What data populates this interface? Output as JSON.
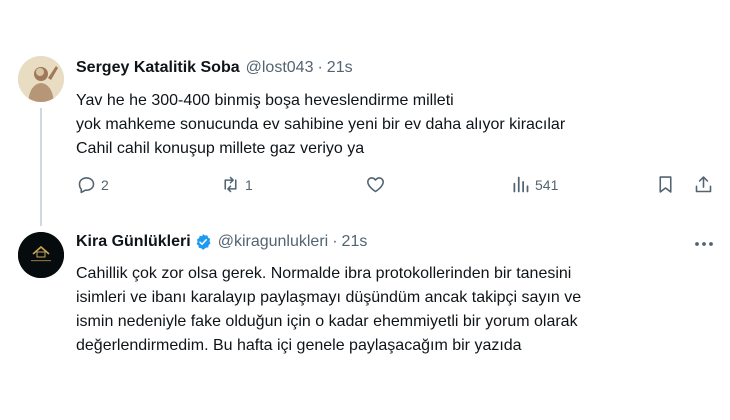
{
  "tweets": [
    {
      "author_name": "Sergey Katalitik Soba",
      "handle": "@lost043",
      "separator": "·",
      "time": "21s",
      "lines": [
        "Yav he he 300-400 binmiş boşa heveslendirme milleti",
        "yok mahkeme sonucunda ev sahibine yeni bir ev daha alıyor kiracılar",
        "Cahil cahil konuşup millete gaz veriyo ya"
      ],
      "reply_count": "2",
      "retweet_count": "1",
      "views_count": "541"
    },
    {
      "author_name": "Kira Günlükleri",
      "handle": "@kiragunlukleri",
      "separator": "·",
      "time": "21s",
      "verified": true,
      "lines": [
        "Cahillik çok zor olsa gerek.  Normalde ibra protokollerinden bir tanesini",
        "isimleri ve ibanı karalayıp paylaşmayı düşündüm ancak takipçi sayın ve",
        "ismin nedeniyle fake olduğun için o kadar ehemmiyetli bir yorum olarak",
        "değerlendirmedim.  Bu hafta içi genele paylaşacağım bir yazıda"
      ]
    }
  ],
  "icons": {
    "reply": "reply-icon",
    "retweet": "retweet-icon",
    "like": "heart-icon",
    "views": "views-icon",
    "bookmark": "bookmark-icon",
    "share": "share-icon",
    "verified": "verified-badge-icon",
    "more": "more-icon"
  },
  "colors": {
    "verified": "#1d9bf0",
    "secondary_text": "#536471",
    "text": "#0f1419"
  }
}
